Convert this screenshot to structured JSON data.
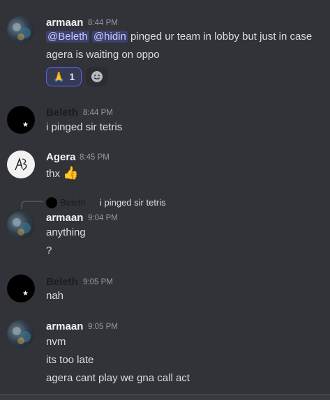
{
  "messages": [
    {
      "author": "armaan",
      "time": "8:44 PM",
      "mention1": "@Beleth",
      "mention2": "@hidin",
      "line1_rest": " pinged ur team in lobby but just in case",
      "line2": "agera is waiting on oppo",
      "reaction": {
        "emoji": "🙏",
        "count": "1"
      }
    },
    {
      "author": "Beleth",
      "time": "8:44 PM",
      "line1": "i pinged sir tetris"
    },
    {
      "author": "Agera",
      "time": "8:45 PM",
      "line1": "thx",
      "emoji": "👍"
    },
    {
      "reply": {
        "author": "Beleth",
        "text": "i pinged sir tetris"
      },
      "author": "armaan",
      "time": "9:04 PM",
      "line1": "anything",
      "line2": "?"
    },
    {
      "author": "Beleth",
      "time": "9:05 PM",
      "line1": "nah"
    },
    {
      "author": "armaan",
      "time": "9:05 PM",
      "line1": "nvm",
      "line2": "its too late",
      "line3": "agera cant play we gna call act"
    }
  ],
  "colors": {
    "background": "#313338",
    "text": "#dbdee1",
    "timestamp": "#949ba4",
    "mention_bg": "#5865f2"
  },
  "icons": {
    "add_reaction": "smiley-icon"
  }
}
